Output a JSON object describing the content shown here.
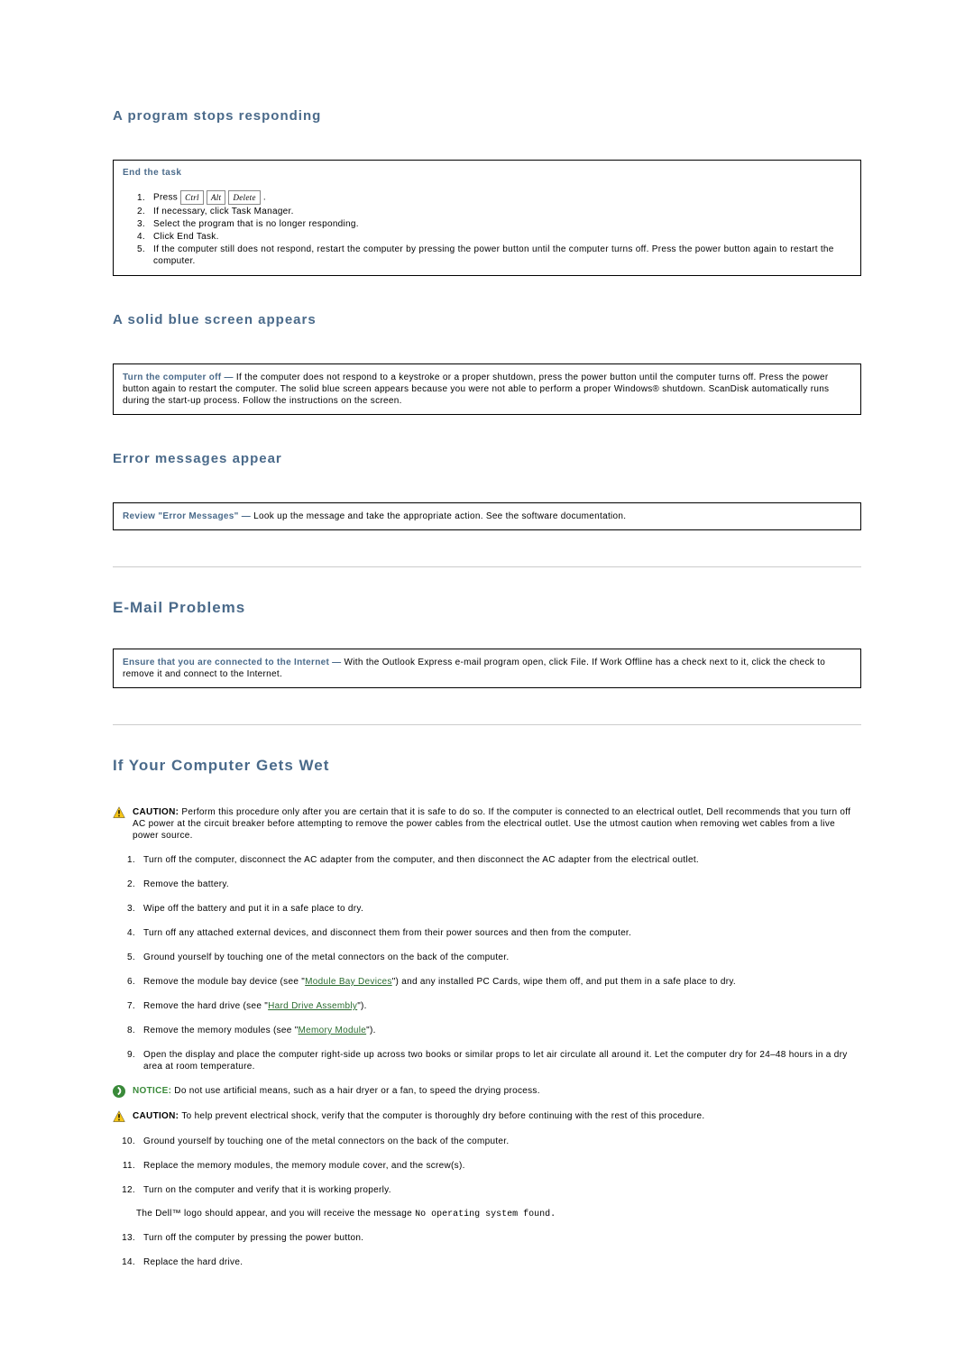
{
  "s1": {
    "heading": "A program stops responding",
    "boxTitle": "End the task",
    "steps": {
      "s0a": "Press ",
      "k1": "Ctrl",
      "k2": "Alt",
      "k3": "Delete",
      "s0b": " .",
      "s1": "If necessary, click Task Manager.",
      "s2": "Select the program that is no longer responding.",
      "s3": "Click End Task.",
      "s4": "If the computer still does not respond, restart the computer by pressing the power button until the computer turns off. Press the power button again to restart the computer."
    }
  },
  "s2": {
    "heading": "A solid blue screen appears",
    "lead": "Turn the computer off — ",
    "body": "If the computer does not respond to a keystroke or a proper shutdown, press the power button until the computer turns off. Press the power button again to restart the computer. The solid blue screen appears because you were not able to perform a proper Windows® shutdown. ScanDisk automatically runs during the start-up process. Follow the instructions on the screen."
  },
  "s3": {
    "heading": "Error messages appear",
    "lead": "Review \"Error Messages\" — ",
    "body": "Look up the message and take the appropriate action. See the software documentation."
  },
  "s4": {
    "heading": "E-Mail Problems",
    "lead": "Ensure that you are connected to the Internet — ",
    "body": "With the Outlook Express e-mail program open, click File. If Work Offline has a check next to it, click the check to remove it and connect to the Internet."
  },
  "s5": {
    "heading": "If Your Computer Gets Wet",
    "caution1": {
      "label": "CAUTION: ",
      "text": "Perform this procedure only after you are certain that it is safe to do so. If the computer is connected to an electrical outlet, Dell recommends that you turn off AC power at the circuit breaker before attempting to remove the power cables from the electrical outlet. Use the utmost caution when removing wet cables from a live power source."
    },
    "steps1": {
      "i1": "Turn off the computer, disconnect the AC adapter from the computer, and then disconnect the AC adapter from the electrical outlet.",
      "i2": "Remove the battery.",
      "i3": "Wipe off the battery and put it in a safe place to dry.",
      "i4": "Turn off any attached external devices, and disconnect them from their power sources and then from the computer.",
      "i5": "Ground yourself by touching one of the metal connectors on the back of the computer.",
      "i6a": "Remove the module bay device (see \"",
      "i6link": "Module Bay Devices",
      "i6b": "\") and any installed PC Cards, wipe them off, and put them in a safe place to dry.",
      "i7a": "Remove the hard drive (see \"",
      "i7link": "Hard Drive Assembly",
      "i7b": "\").",
      "i8a": "Remove the memory modules (see \"",
      "i8link": "Memory Module",
      "i8b": "\").",
      "i9": "Open the display and place the computer right-side up across two books or similar props to let air circulate all around it. Let the computer dry for 24–48 hours in a dry area at room temperature."
    },
    "notice": {
      "label": "NOTICE: ",
      "text": "Do not use artificial means, such as a hair dryer or a fan, to speed the drying process."
    },
    "caution2": {
      "label": "CAUTION: ",
      "text": "To help prevent electrical shock, verify that the computer is thoroughly dry before continuing with the rest of this procedure."
    },
    "steps2": {
      "i10": "Ground yourself by touching one of the metal connectors on the back of the computer.",
      "i11": "Replace the memory modules, the memory module cover, and the screw(s).",
      "i12": "Turn on the computer and verify that it is working properly."
    },
    "para1a": "The Dell™ logo should appear, and you will receive the message ",
    "para1code": "No operating system found.",
    "steps3": {
      "i13": "Turn off the computer by pressing the power button.",
      "i14": "Replace the hard drive."
    }
  }
}
